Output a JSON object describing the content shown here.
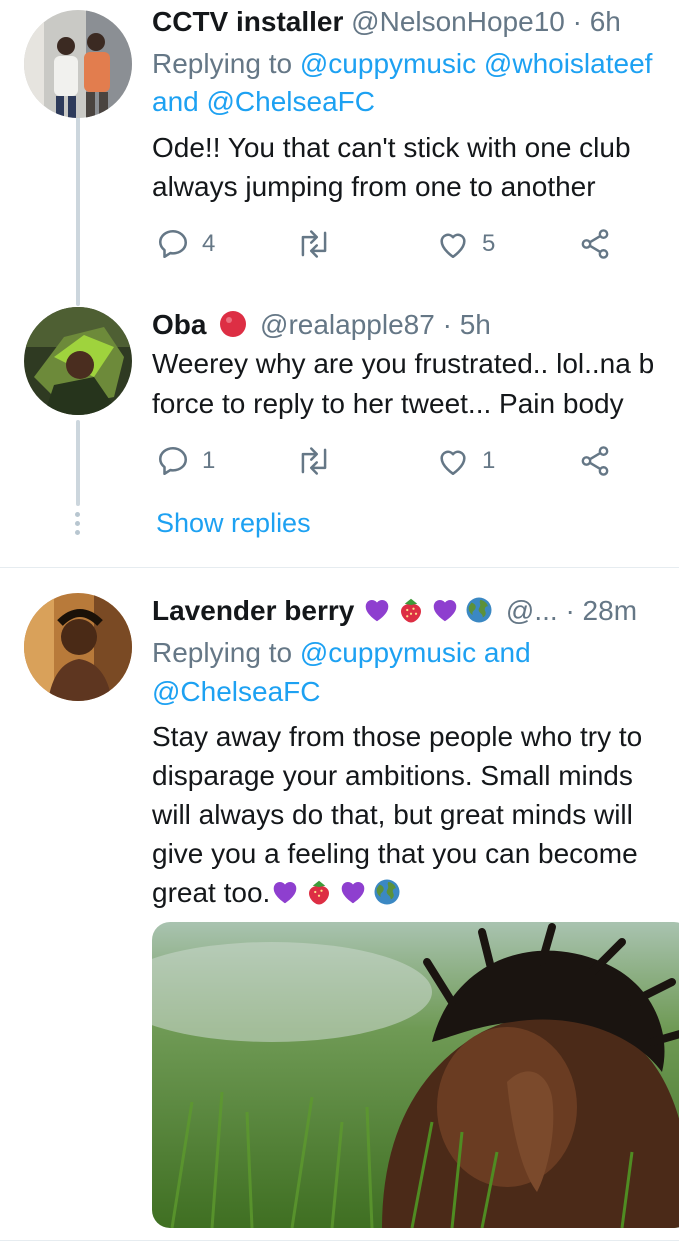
{
  "replies": [
    {
      "display_name": "CCTV installer",
      "handle": "@NelsonHope10",
      "separator": "·",
      "time": "6h",
      "replying_label": "Replying to",
      "mention_1": "@cuppymusic",
      "mention_2": "@whoislateef",
      "mention_and": "and",
      "mention_3": "@ChelseaFC",
      "text_lines": [
        "Ode!! You that can't stick with one club",
        "always jumping from one to another"
      ],
      "reply_count": "4",
      "like_count": "5"
    },
    {
      "display_name": "Oba",
      "handle": "@realapple87",
      "separator": "·",
      "time": "5h",
      "text_lines": [
        "Weerey why are you frustrated.. lol..na b",
        "force to reply to her tweet... Pain body"
      ],
      "reply_count": "1",
      "like_count": "1",
      "show_replies": "Show replies"
    },
    {
      "display_name": "Lavender berry",
      "handle": "@...",
      "separator": "·",
      "time": "28m",
      "replying_label": "Replying to",
      "mention_1": "@cuppymusic",
      "mention_and": "and",
      "mention_2": "@ChelseaFC",
      "text_lines": [
        "Stay away from those people who try to",
        "disparage your ambitions. Small minds",
        "will always do that, but great minds will",
        "give you a feeling that you can become",
        "great too."
      ]
    }
  ],
  "icons": {
    "reply": "speech-bubble-icon",
    "retweet": "retweet-icon",
    "like": "heart-icon",
    "share": "share-icon",
    "emoji_set": [
      "purple-heart",
      "strawberry",
      "purple-heart",
      "globe"
    ]
  },
  "colors": {
    "link": "#1da1f2",
    "muted": "#657786",
    "text": "#14171a",
    "thread_line": "#ccd6dd",
    "purple_heart": "#8e3fcf",
    "red_circle": "#dd2e44"
  }
}
